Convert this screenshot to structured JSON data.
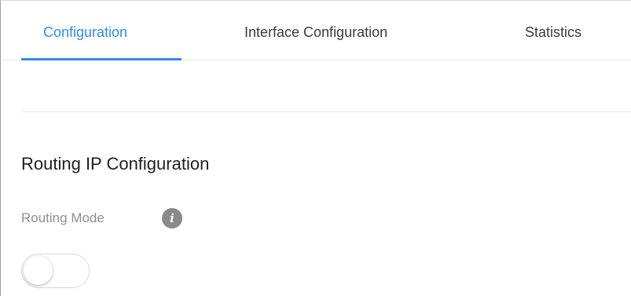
{
  "tabs": {
    "configuration": "Configuration",
    "interface_configuration": "Interface Configuration",
    "statistics": "Statistics",
    "active": "Configuration"
  },
  "section": {
    "title": "Routing IP Configuration"
  },
  "routing_mode": {
    "label": "Routing Mode",
    "info_icon_glyph": "i",
    "enabled": false
  },
  "colors": {
    "accent": "#2d8cf0",
    "info_icon": "#8a8a8a",
    "label_muted": "#8f8f8f"
  }
}
